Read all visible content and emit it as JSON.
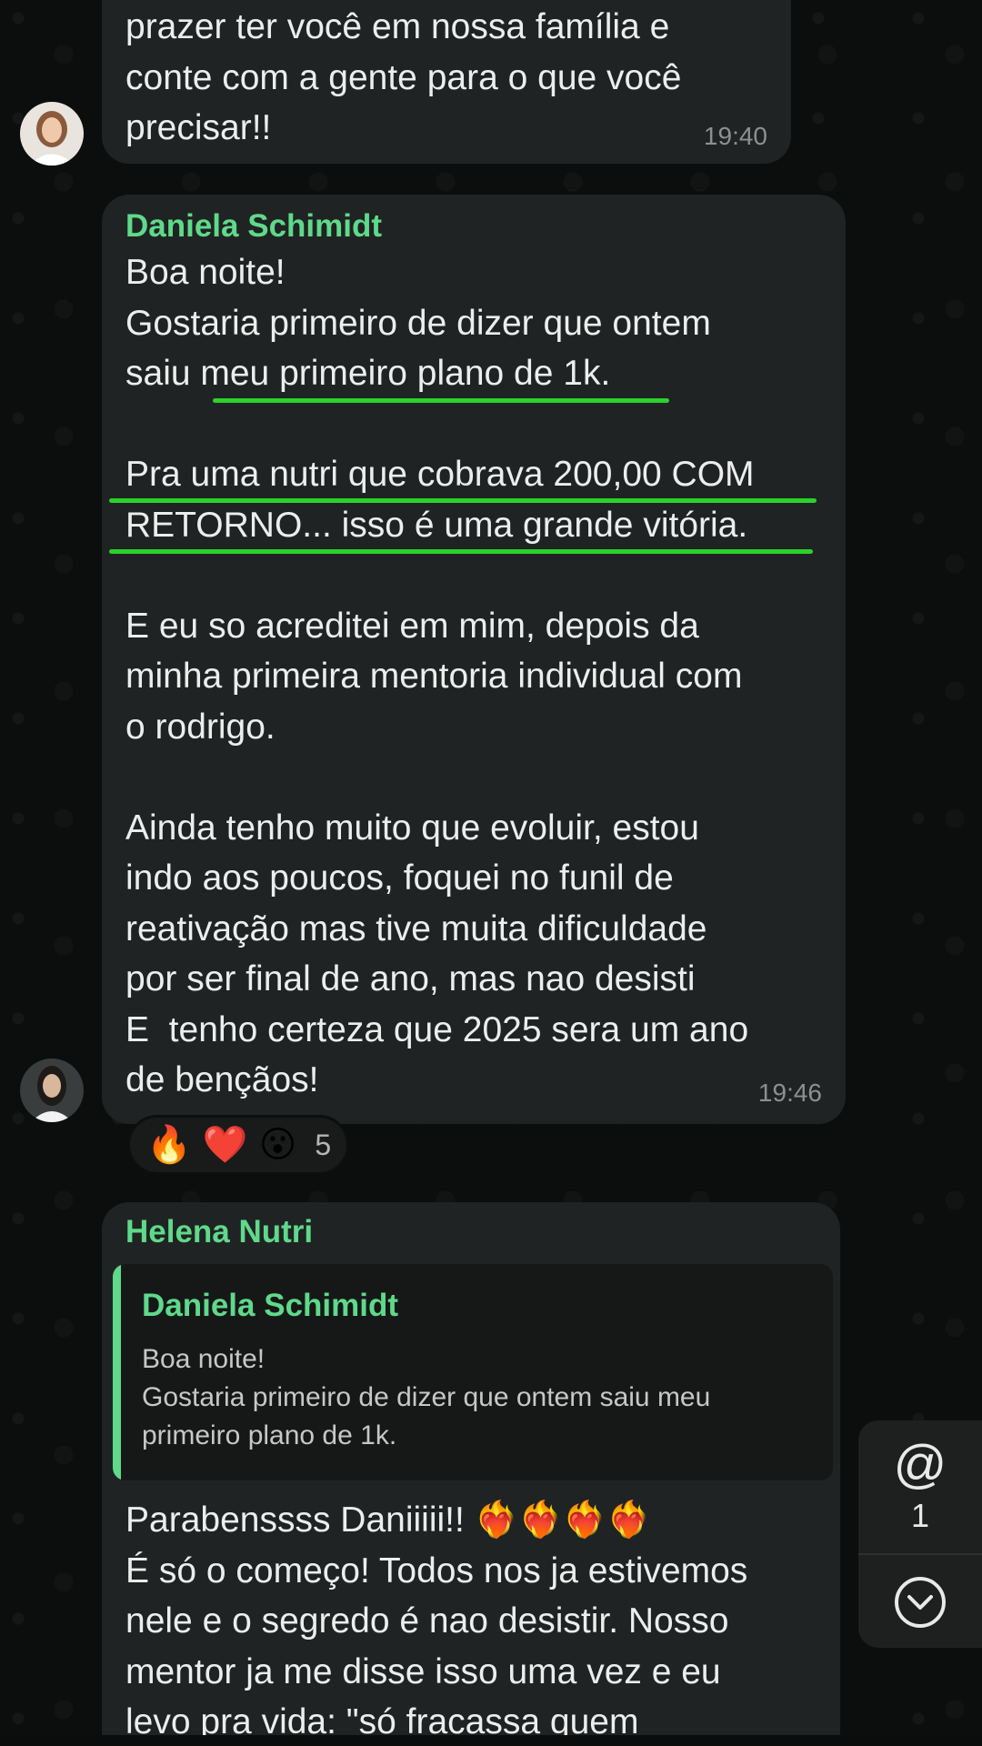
{
  "messages": [
    {
      "text": "prazer ter você em nossa família e\nconte com a gente para o que você\nprecisar!!",
      "time": "19:40"
    },
    {
      "sender": "Daniela Schimidt",
      "text": "Boa noite!\nGostaria primeiro de dizer que ontem\nsaiu meu primeiro plano de 1k. \n\nPra uma nutri que cobrava 200,00 COM\nRETORNO... isso é uma grande vitória.\n\nE eu so acreditei em mim, depois da\nminha primeira mentoria individual com\no rodrigo.\n\nAinda tenho muito que evoluir, estou\nindo aos poucos, foquei no funil de\nreativação mas tive muita dificuldade\npor ser final de ano, mas nao desisti\nE  tenho certeza que 2025 sera um ano\nde bençãos!",
      "time": "19:46",
      "reactions": {
        "emojis": [
          "🔥",
          "❤️",
          "😮"
        ],
        "count": "5"
      }
    },
    {
      "sender": "Helena Nutri",
      "quote": {
        "sender": "Daniela Schimidt",
        "text": "Boa noite!\nGostaria primeiro de dizer que ontem saiu meu\nprimeiro plano de 1k."
      },
      "text": "Parabenssss Daniiiii!! ❤️‍🔥❤️‍🔥❤️‍🔥❤️‍🔥\nÉ só o começo! Todos nos ja estivemos\nnele e o segredo é nao desistir. Nosso\nmentor ja me disse isso uma vez e eu\nlevo pra vida: \"só fracassa quem"
    }
  ],
  "side_panel": {
    "mention_symbol": "@",
    "mention_count": "1"
  },
  "colors": {
    "sender_name": "#5fd98a",
    "highlight_underline": "#2bd22b",
    "bubble": "#202323"
  }
}
